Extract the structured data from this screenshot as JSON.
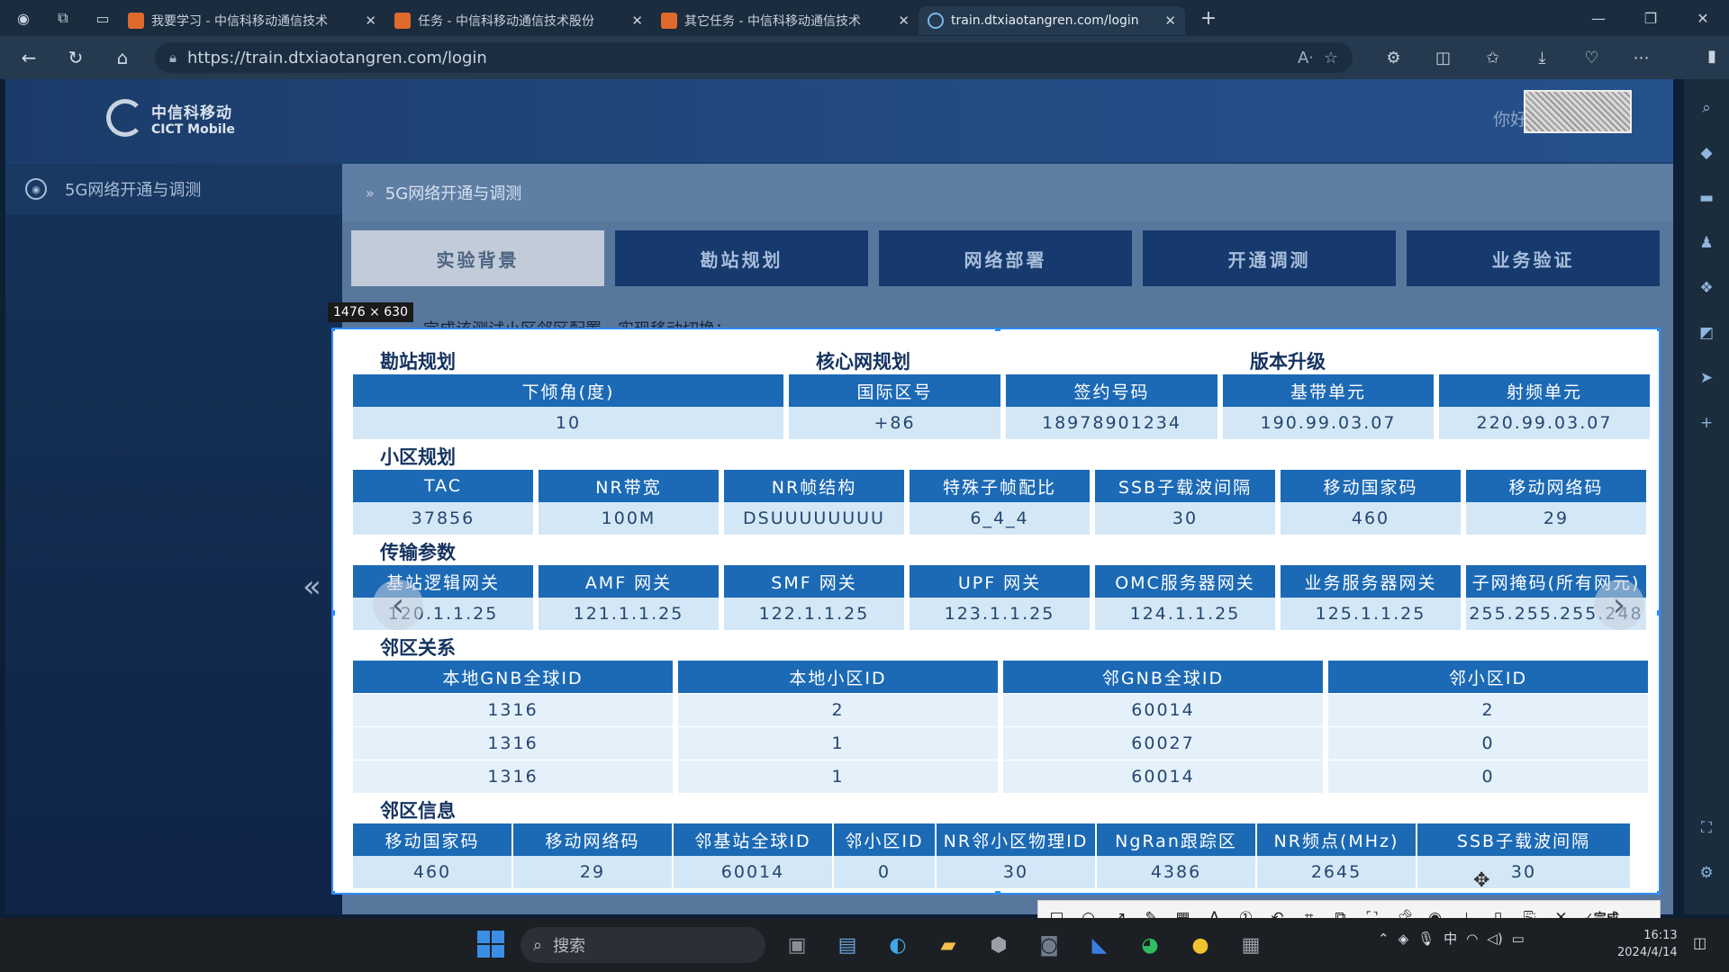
{
  "browser": {
    "tabs": [
      {
        "title": "我要学习 - 中信科移动通信技术",
        "active": false
      },
      {
        "title": "任务 - 中信科移动通信技术股份",
        "active": false
      },
      {
        "title": "其它任务 - 中信科移动通信技术",
        "active": false
      },
      {
        "title": "train.dtxiaotangren.com/login",
        "active": true
      }
    ],
    "url": "https://train.dtxiaotangren.com/login"
  },
  "app": {
    "logo_cn": "中信科移动",
    "logo_en": "CICT Mobile",
    "greeting": "你好",
    "sidebar_item": "5G网络开通与调测",
    "breadcrumb": "5G网络开通与调测",
    "steps": [
      {
        "label": "实验背景",
        "active": true
      },
      {
        "label": "勘站规划",
        "active": false
      },
      {
        "label": "网络部署",
        "active": false
      },
      {
        "label": "开通调测",
        "active": false
      },
      {
        "label": "业务验证",
        "active": false
      }
    ],
    "intro_text": "完成该测试小区邻区配置，实现移动切换；"
  },
  "selection_size": "1476 × 630",
  "sheet": {
    "site_planning": {
      "title": "勘站规划",
      "headers": [
        "下倾角(度)"
      ],
      "values": [
        "10"
      ]
    },
    "core_planning": {
      "title": "核心网规划",
      "headers": [
        "国际区号",
        "签约号码"
      ],
      "values": [
        "+86",
        "18978901234"
      ]
    },
    "version_upgrade": {
      "title": "版本升级",
      "headers": [
        "基带单元",
        "射频单元"
      ],
      "values": [
        "190.99.03.07",
        "220.99.03.07"
      ]
    },
    "cell_planning": {
      "title": "小区规划",
      "headers": [
        "TAC",
        "NR带宽",
        "NR帧结构",
        "特殊子帧配比",
        "SSB子载波间隔",
        "移动国家码",
        "移动网络码"
      ],
      "values": [
        "37856",
        "100M",
        "DSUUUUUUUU",
        "6_4_4",
        "30",
        "460",
        "29"
      ]
    },
    "transport": {
      "title": "传输参数",
      "headers": [
        "基站逻辑网关",
        "AMF 网关",
        "SMF 网关",
        "UPF 网关",
        "OMC服务器网关",
        "业务服务器网关",
        "子网掩码(所有网元)"
      ],
      "values": [
        "120.1.1.25",
        "121.1.1.25",
        "122.1.1.25",
        "123.1.1.25",
        "124.1.1.25",
        "125.1.1.25",
        "255.255.255.248"
      ]
    },
    "neighbor_relation": {
      "title": "邻区关系",
      "headers": [
        "本地GNB全球ID",
        "本地小区ID",
        "邻GNB全球ID",
        "邻小区ID"
      ],
      "rows": [
        [
          "1316",
          "2",
          "60014",
          "2"
        ],
        [
          "1316",
          "1",
          "60027",
          "0"
        ],
        [
          "1316",
          "1",
          "60014",
          "0"
        ]
      ]
    },
    "neighbor_info": {
      "title": "邻区信息",
      "headers": [
        "移动国家码",
        "移动网络码",
        "邻基站全球ID",
        "邻小区ID",
        "NR邻小区物理ID",
        "NgRan跟踪区",
        "NR频点(MHz)",
        "SSB子载波间隔"
      ],
      "values": [
        "460",
        "29",
        "60014",
        "0",
        "30",
        "4386",
        "2645",
        "30"
      ]
    }
  },
  "snip_toolbar": {
    "done_label": "完成"
  },
  "taskbar": {
    "search_placeholder": "搜索",
    "ime": "中",
    "time": "16:13",
    "date": "2024/4/14"
  }
}
